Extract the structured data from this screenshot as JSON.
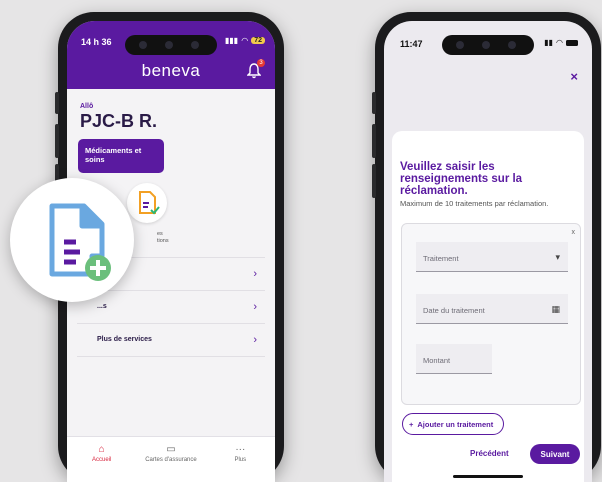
{
  "left_phone": {
    "status_time": "14 h 36",
    "battery": "72",
    "brand": "beneva",
    "notification_count": "3",
    "greeting": "Allô",
    "user_name": "PJC-B R.",
    "card_label": "Médicaments et soins",
    "icon_label_partial": "...es\n...ions",
    "rows": [
      {
        "label": ""
      },
      {
        "label": "...s"
      },
      {
        "label": "Plus de services"
      }
    ],
    "tabs": [
      {
        "label": "Accueil",
        "icon": "home-icon"
      },
      {
        "label": "Cartes d'assurance",
        "icon": "card-icon"
      },
      {
        "label": "Plus",
        "icon": "more-icon"
      }
    ]
  },
  "right_phone": {
    "status_time": "11:47",
    "close": "×",
    "title": "Veuillez saisir les renseignements sur la réclamation.",
    "subtitle": "Maximum de 10 traitements par réclamation.",
    "remove_x": "x",
    "fields": {
      "treatment_placeholder": "Traitement",
      "date_placeholder": "Date du traitement",
      "amount_placeholder": "Montant"
    },
    "add_button": "Ajouter un traitement",
    "add_symbol": "+",
    "prev_button": "Précédent",
    "next_button": "Suivant"
  },
  "colors": {
    "brand_purple": "#5a1aa0",
    "accent_red": "#d8263e",
    "overlay_icon_blue": "#6aa8e0",
    "overlay_plus_green": "#6bbf7c"
  }
}
